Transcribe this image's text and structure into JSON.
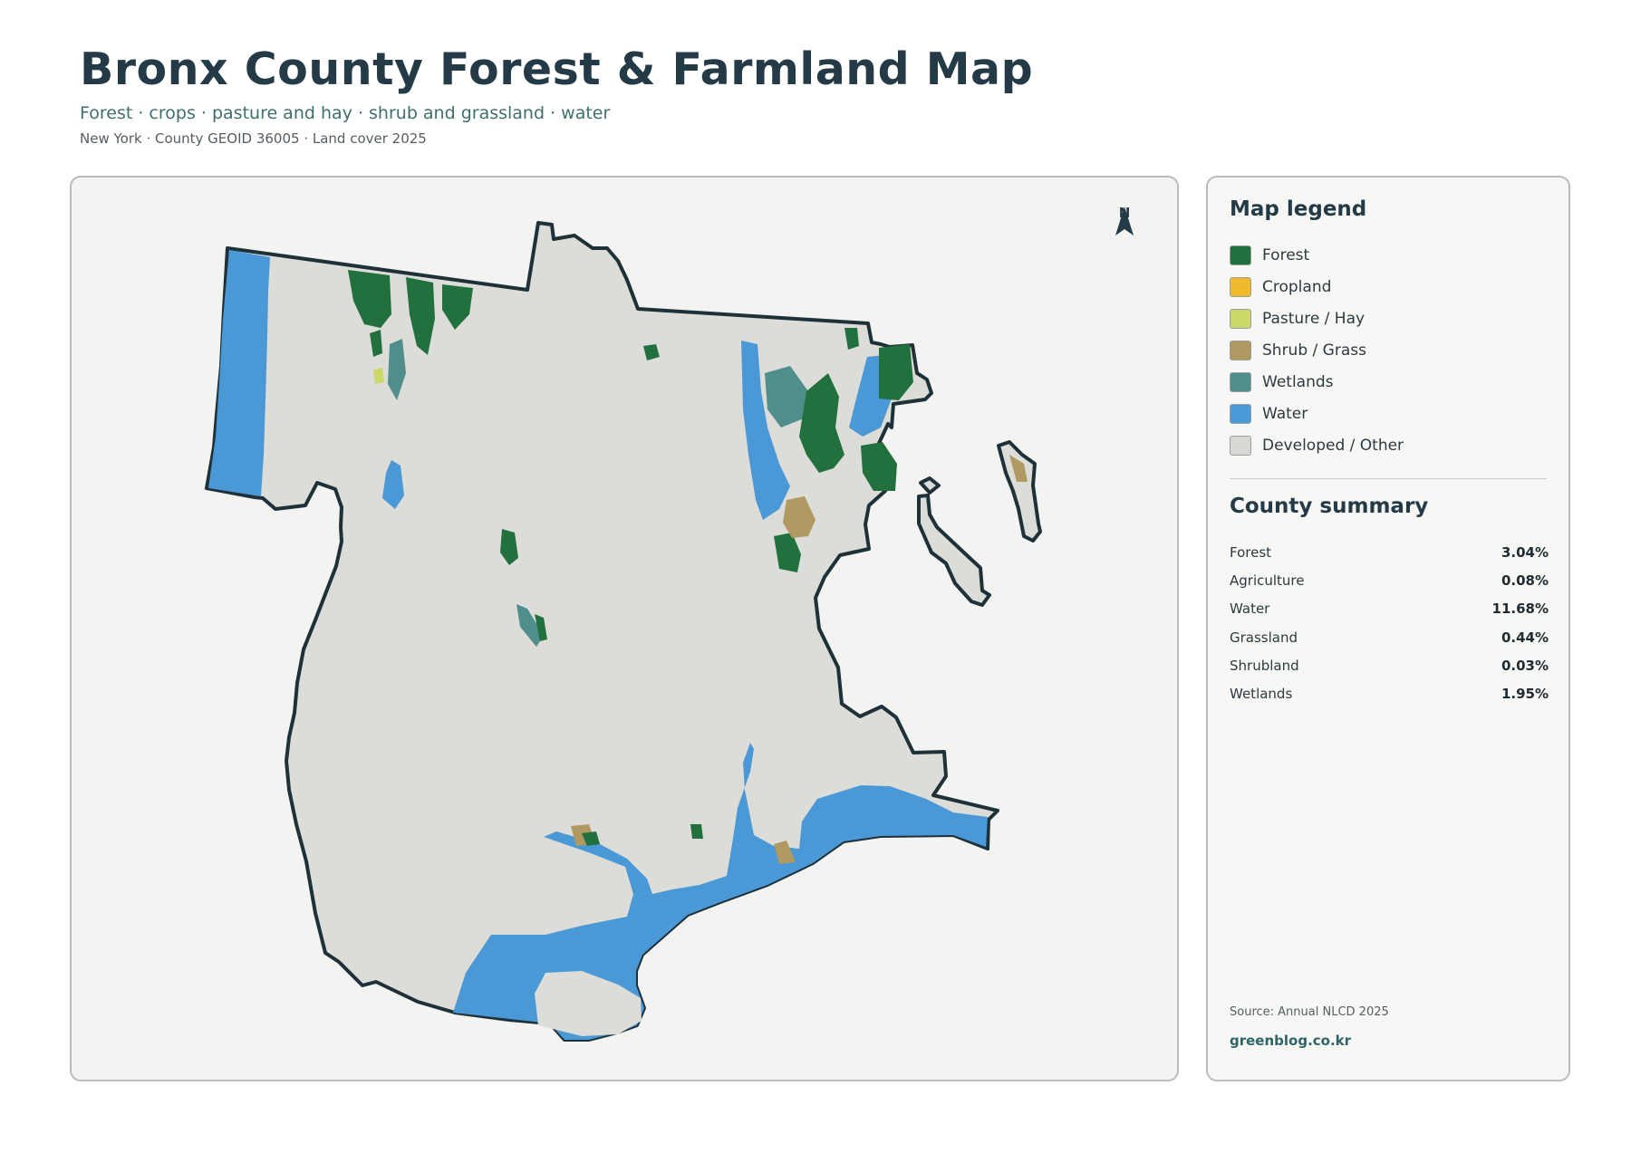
{
  "header": {
    "title": "Bronx County Forest & Farmland Map",
    "subtitle": "Forest · crops · pasture and hay · shrub and grassland · water",
    "meta": "New York · County GEOID 36005 · Land cover 2025"
  },
  "map": {
    "north_label": "N",
    "colors": {
      "forest": "#23703f",
      "cropland": "#f0b92e",
      "pasture": "#ccd96a",
      "shrub": "#b09a62",
      "wetlands": "#4f8e8b",
      "water": "#4a98d6",
      "developed": "#dcdcd8",
      "outline": "#1e3038",
      "panel": "#f3f3f1"
    }
  },
  "legend": {
    "title": "Map legend",
    "items": [
      {
        "label": "Forest",
        "color": "#23703f"
      },
      {
        "label": "Cropland",
        "color": "#f0b92e"
      },
      {
        "label": "Pasture / Hay",
        "color": "#ccd96a"
      },
      {
        "label": "Shrub / Grass",
        "color": "#b09a62"
      },
      {
        "label": "Wetlands",
        "color": "#4f8e8b"
      },
      {
        "label": "Water",
        "color": "#4a98d6"
      },
      {
        "label": "Developed / Other",
        "color": "#d8d8d4"
      }
    ]
  },
  "summary": {
    "title": "County summary",
    "rows": [
      {
        "name": "Forest",
        "value": "3.04%"
      },
      {
        "name": "Agriculture",
        "value": "0.08%"
      },
      {
        "name": "Water",
        "value": "11.68%"
      },
      {
        "name": "Grassland",
        "value": "0.44%"
      },
      {
        "name": "Shrubland",
        "value": "0.03%"
      },
      {
        "name": "Wetlands",
        "value": "1.95%"
      }
    ]
  },
  "footer": {
    "source": "Source: Annual NLCD 2025",
    "site": "greenblog.co.kr"
  }
}
